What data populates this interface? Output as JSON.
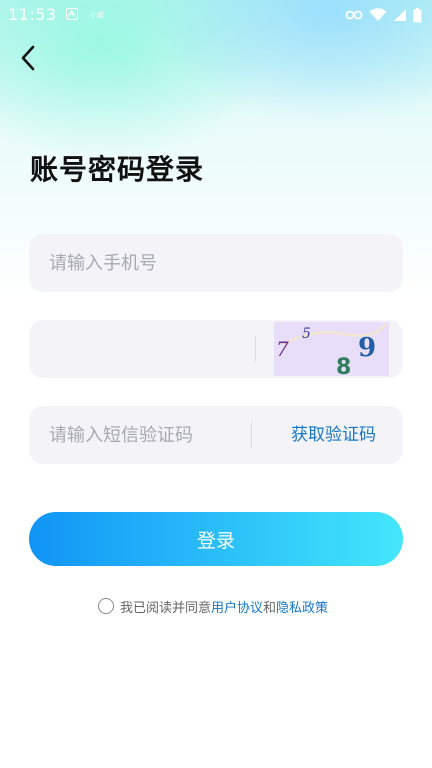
{
  "status_bar": {
    "time": "11:53",
    "small_text": "小说"
  },
  "header": {
    "title": "账号密码登录"
  },
  "form": {
    "phone": {
      "placeholder": "请输入手机号",
      "value": ""
    },
    "captcha": {
      "value": "",
      "image_characters": [
        "7",
        "5",
        "8",
        "9"
      ]
    },
    "sms": {
      "placeholder": "请输入短信验证码",
      "value": "",
      "button_label": "获取验证码"
    }
  },
  "login_button": {
    "label": "登录"
  },
  "agreement": {
    "prefix": "我已阅读并同意",
    "user_agreement": "用户协议",
    "connector": "和",
    "privacy_policy": "隐私政策",
    "checked": false
  },
  "colors": {
    "accent": "#1677c9",
    "button_gradient_start": "#1094f6",
    "button_gradient_end": "#44e7fb",
    "field_background": "#f3f3f8"
  }
}
